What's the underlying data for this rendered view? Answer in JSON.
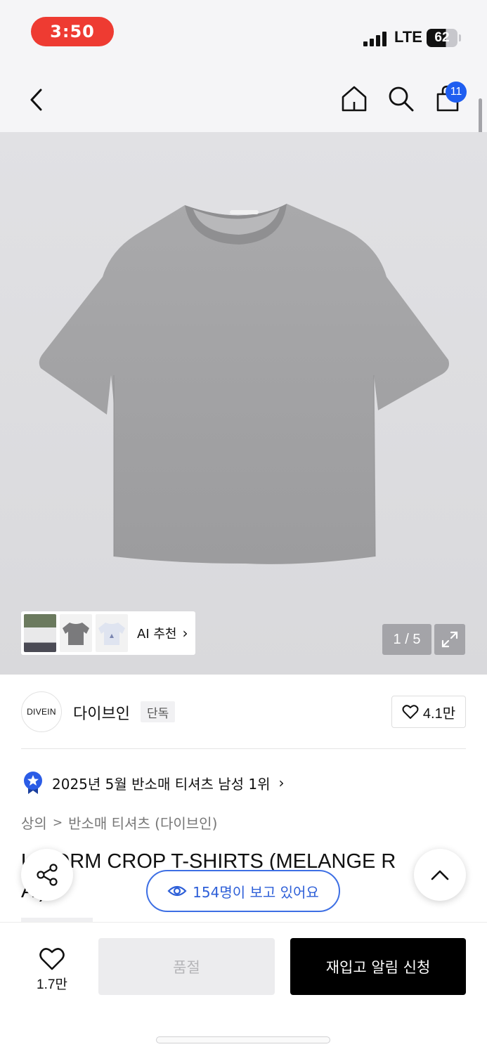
{
  "status_bar": {
    "time": "3:50",
    "network": "LTE",
    "battery": "62"
  },
  "nav": {
    "cart_count": "11"
  },
  "gallery": {
    "ai_label": "AI 추천",
    "page_counter": "1 / 5"
  },
  "brand": {
    "logo_text": "DIVEIN",
    "name": "다이브인",
    "tag": "단독",
    "likes": "4.1만"
  },
  "ranking": {
    "text": "2025년 5월 반소매 티셔츠 남성 1위"
  },
  "breadcrumb": {
    "category": "상의",
    "subcategory": "반소매 티셔츠 (다이브인)"
  },
  "product": {
    "title_line1": "U  FORM CROP T-SHIRTS (MELANGE  R",
    "title_line2": "A  )"
  },
  "viewers": {
    "text": "154명이 보고 있어요"
  },
  "bottom_bar": {
    "wish_count": "1.7만",
    "soldout_label": "품절",
    "restock_label": "재입고 알림 신청"
  },
  "colors": {
    "accent_blue": "#1f5ef0",
    "time_pill": "#ee3b32",
    "primary_button": "#000000"
  }
}
